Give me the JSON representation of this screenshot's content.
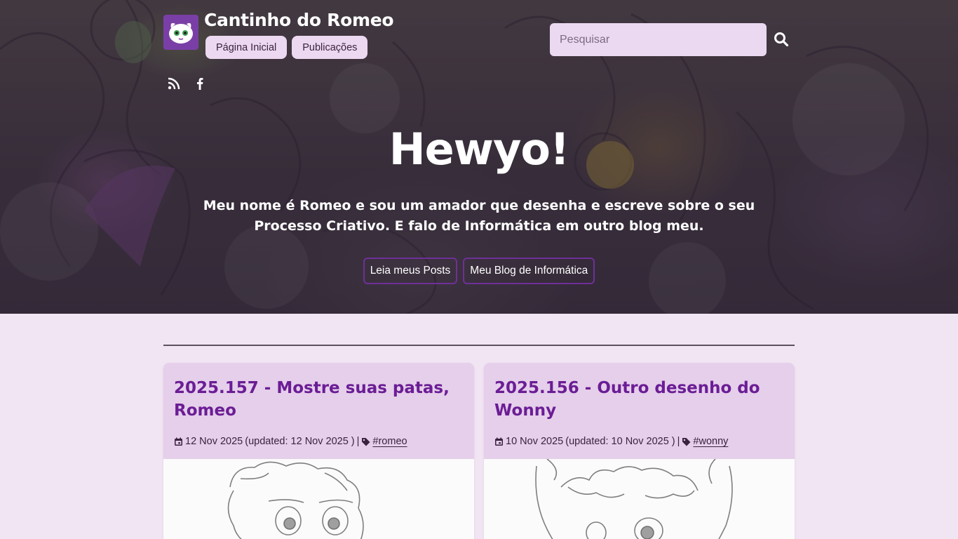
{
  "header": {
    "site_title": "Cantinho do Romeo",
    "nav": [
      "Página Inicial",
      "Publicações"
    ],
    "search_placeholder": "Pesquisar",
    "social_icons": [
      "rss-icon",
      "facebook-icon"
    ],
    "logo_icon": "romeo-face-logo"
  },
  "hero": {
    "title": "Hewyo!",
    "subtitle": "Meu nome é Romeo e sou um amador que desenha e escreve sobre o seu Processo Criativo. E falo de Informática em outro blog meu.",
    "buttons": [
      "Leia meus Posts",
      "Meu Blog de Informática"
    ]
  },
  "posts": [
    {
      "title": "2025.157 - Mostre suas patas, Romeo",
      "date": "12 Nov 2025",
      "updated": "(updated: 12 Nov 2025 )",
      "separator": "|",
      "tag": "#romeo"
    },
    {
      "title": "2025.156 - Outro desenho do Wonny",
      "date": "10 Nov 2025",
      "updated": "(updated: 10 Nov 2025 )",
      "separator": "|",
      "tag": "#wonny"
    }
  ],
  "colors": {
    "accent": "#6b1d95",
    "card_header": "#e5cfea",
    "page_bg": "#f1e4f3",
    "button_bg": "#ecd8f0",
    "cta_border": "#6f2f99"
  }
}
